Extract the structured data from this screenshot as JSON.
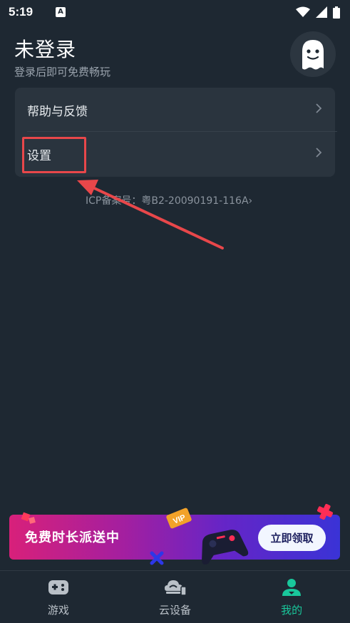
{
  "status_bar": {
    "time": "5:19",
    "app_icon_letter": "A",
    "icons": [
      "wifi-icon",
      "signal-icon",
      "battery-icon"
    ]
  },
  "header": {
    "title": "未登录",
    "subtitle": "登录后即可免费畅玩"
  },
  "menu": {
    "items": [
      {
        "label": "帮助与反馈",
        "icon": "chevron-right-icon"
      },
      {
        "label": "设置",
        "icon": "chevron-right-icon"
      }
    ]
  },
  "icp": "ICP备案号：粤B2-20090191-116A",
  "banner": {
    "text": "免费时长派送中",
    "button_label": "立即领取",
    "badge_text": "VIP"
  },
  "bottom_nav": {
    "items": [
      {
        "label": "游戏",
        "icon": "gamepad-icon",
        "active": false
      },
      {
        "label": "云设备",
        "icon": "cloud-device-icon",
        "active": false
      },
      {
        "label": "我的",
        "icon": "user-icon",
        "active": true
      }
    ]
  },
  "colors": {
    "background": "#1e2832",
    "card": "#2a343e",
    "accent": "#19c79b",
    "annotation": "#e8474a"
  }
}
